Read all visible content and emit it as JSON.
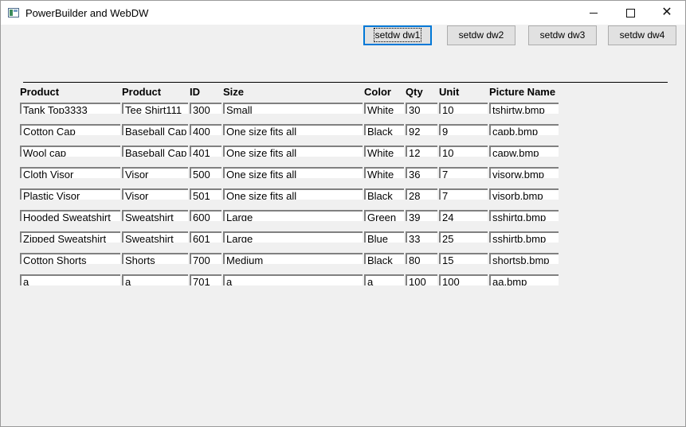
{
  "window": {
    "title": "PowerBuilder and WebDW",
    "controls": {
      "minimize": "─",
      "maximize": "☐",
      "close": "✕"
    }
  },
  "toolbar": {
    "buttons": [
      "setdw dw1",
      "setdw dw2",
      "setdw dw3",
      "setdw dw4"
    ]
  },
  "table": {
    "columns": [
      "Product",
      "Product",
      "ID",
      "Size",
      "Color",
      "Qty",
      "Unit",
      "Picture Name"
    ],
    "rows": [
      [
        "Tank Top3333",
        "Tee Shirt111",
        "300",
        "Small",
        "White",
        "30",
        "10",
        "tshirtw.bmp"
      ],
      [
        "Cotton Cap",
        "Baseball Cap",
        "400",
        "One size fits all",
        "Black",
        "92",
        "9",
        "capb.bmp"
      ],
      [
        "Wool cap",
        "Baseball Cap",
        "401",
        "One size fits all",
        "White",
        "12",
        "10",
        "capw.bmp"
      ],
      [
        "Cloth Visor",
        "Visor",
        "500",
        "One size fits all",
        "White",
        "36",
        "7",
        "visorw.bmp"
      ],
      [
        "Plastic Visor",
        "Visor",
        "501",
        "One size fits all",
        "Black",
        "28",
        "7",
        "visorb.bmp"
      ],
      [
        "Hooded Sweatshirt",
        "Sweatshirt",
        "600",
        "Large",
        "Green",
        "39",
        "24",
        "sshirtg.bmp"
      ],
      [
        "Zipped Sweatshirt",
        "Sweatshirt",
        "601",
        "Large",
        "Blue",
        "33",
        "25",
        "sshirtb.bmp"
      ],
      [
        "Cotton Shorts",
        "Shorts",
        "700",
        "Medium",
        "Black",
        "80",
        "15",
        "shortsb.bmp"
      ],
      [
        "a",
        "a",
        "701",
        "a",
        "a",
        "100",
        "100",
        "aa.bmp"
      ]
    ]
  }
}
